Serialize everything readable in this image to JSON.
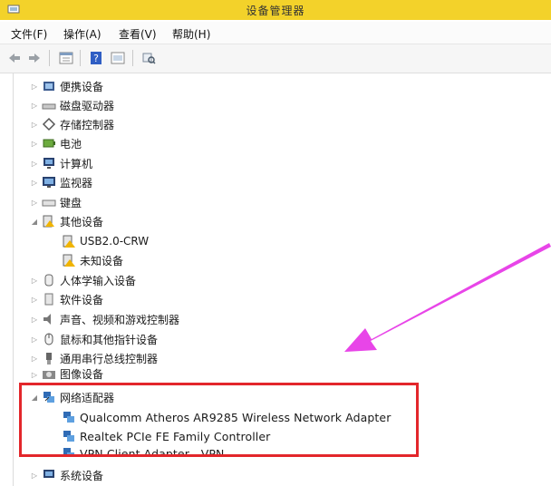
{
  "window": {
    "title": "设备管理器"
  },
  "menu": [
    {
      "label": "文件(F)"
    },
    {
      "label": "操作(A)"
    },
    {
      "label": "查看(V)"
    },
    {
      "label": "帮助(H)"
    }
  ],
  "toolbar": {
    "buttons": [
      "back-arrow-icon",
      "forward-arrow-icon",
      "properties-icon",
      "help-icon",
      "view-icon",
      "scan-icon"
    ]
  },
  "tree": {
    "categories": [
      {
        "label": "便携设备",
        "expanded": false
      },
      {
        "label": "磁盘驱动器",
        "expanded": false
      },
      {
        "label": "存储控制器",
        "expanded": false
      },
      {
        "label": "电池",
        "expanded": false
      },
      {
        "label": "计算机",
        "expanded": false
      },
      {
        "label": "监视器",
        "expanded": false
      },
      {
        "label": "键盘",
        "expanded": false
      },
      {
        "label": "其他设备",
        "expanded": true,
        "children": [
          {
            "label": "USB2.0-CRW"
          },
          {
            "label": "未知设备"
          }
        ]
      },
      {
        "label": "人体学输入设备",
        "expanded": false
      },
      {
        "label": "软件设备",
        "expanded": false
      },
      {
        "label": "声音、视频和游戏控制器",
        "expanded": false
      },
      {
        "label": "鼠标和其他指针设备",
        "expanded": false
      },
      {
        "label": "通用串行总线控制器",
        "expanded": false
      },
      {
        "label": "图像设备",
        "expanded": false
      },
      {
        "label": "网络适配器",
        "expanded": true,
        "children": [
          {
            "label": "Qualcomm Atheros AR9285 Wireless Network Adapter"
          },
          {
            "label": "Realtek PCIe FE Family Controller"
          },
          {
            "label": "VPN Client Adapter - VPN"
          }
        ]
      },
      {
        "label": "系统设备",
        "expanded": false
      }
    ]
  },
  "annotation": {
    "highlight_color": "#e3262b",
    "arrow_color": "#e845e8"
  }
}
